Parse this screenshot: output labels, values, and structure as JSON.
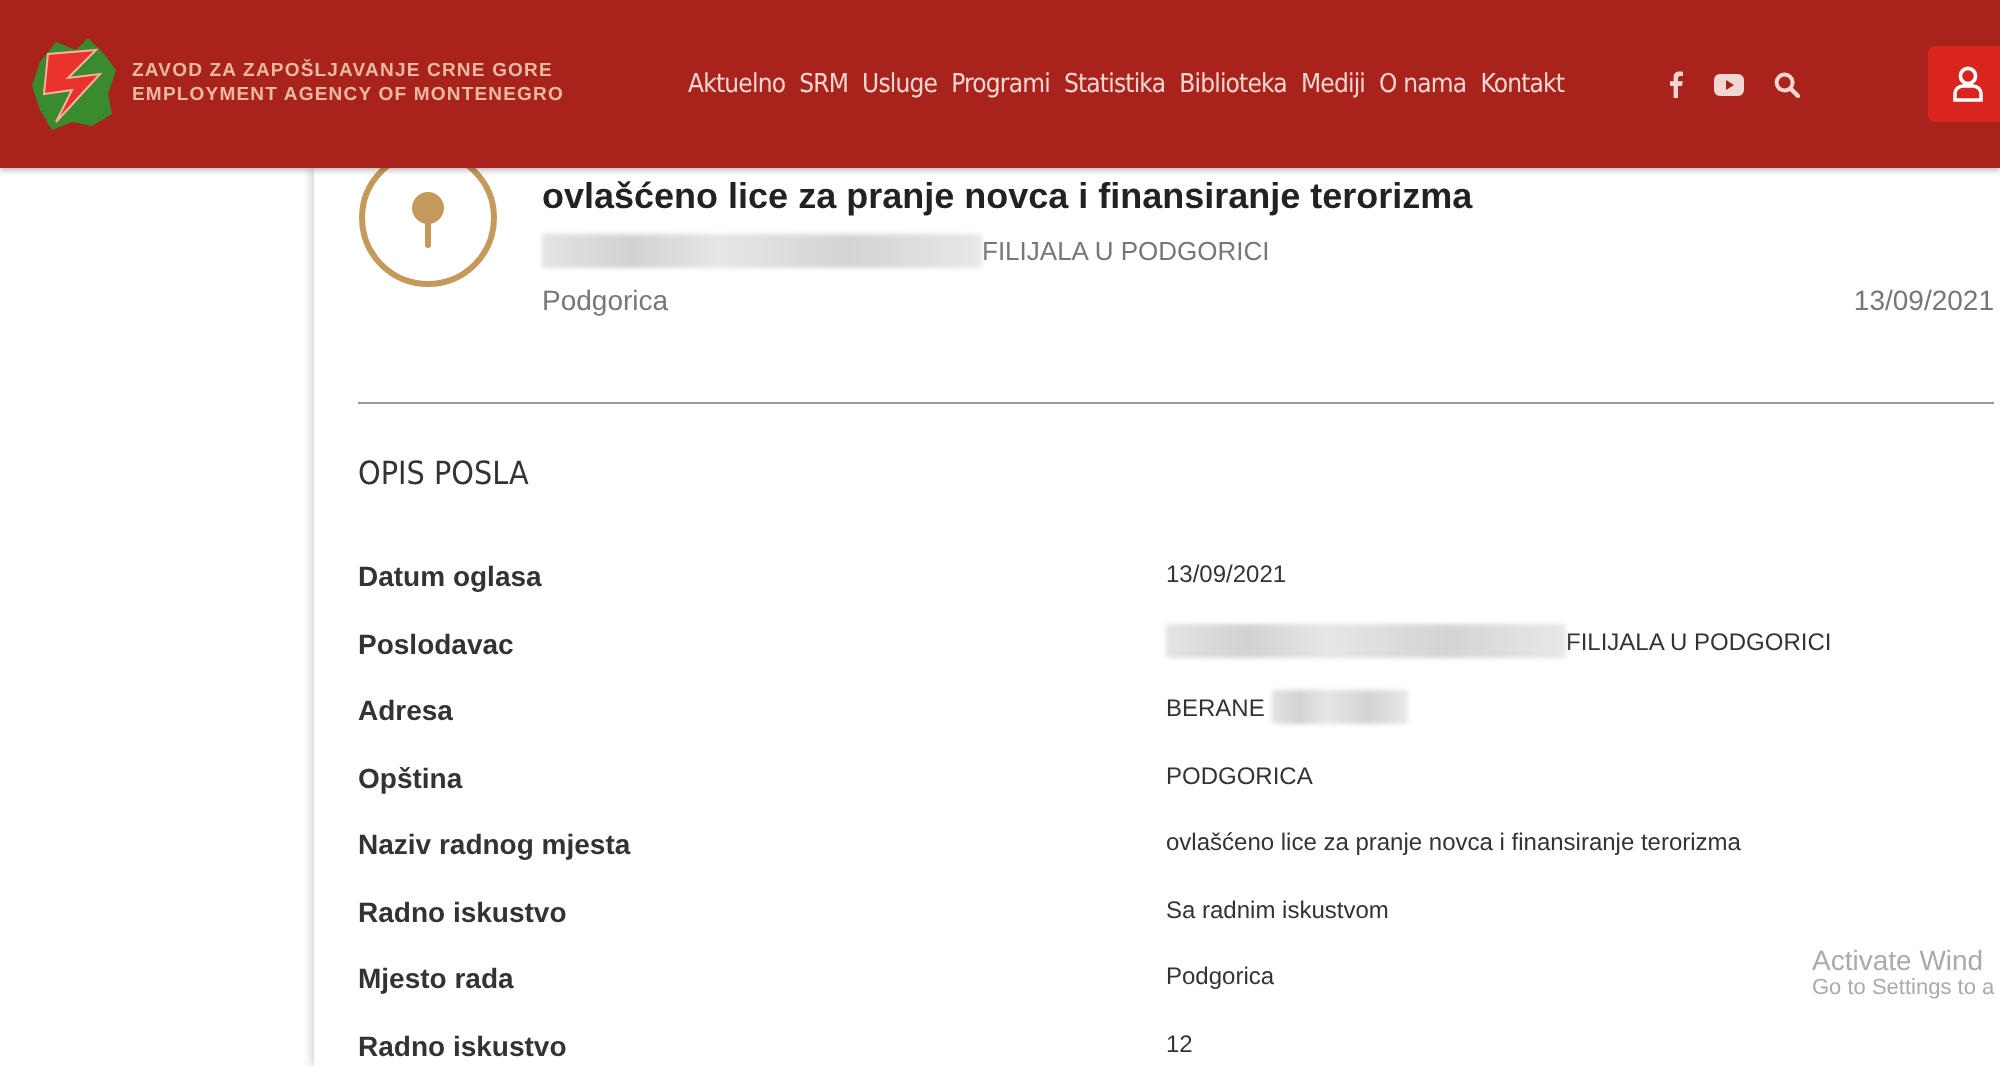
{
  "header": {
    "logo_line_1": "ZAVOD ZA ZAPOŠLJAVANJE CRNE GORE",
    "logo_line_2": "EMPLOYMENT AGENCY OF MONTENEGRO",
    "nav": [
      {
        "label": "Aktuelno"
      },
      {
        "label": "SRM"
      },
      {
        "label": "Usluge"
      },
      {
        "label": "Programi"
      },
      {
        "label": "Statistika"
      },
      {
        "label": "Biblioteka"
      },
      {
        "label": "Mediji"
      },
      {
        "label": "O nama"
      },
      {
        "label": "Kontakt"
      }
    ]
  },
  "job": {
    "title": "ovlašćeno lice za pranje novca i finansiranje terorizma",
    "employer": "FILIJALA U PODGORICI",
    "blurred_before": true,
    "city": "Podgorica",
    "date": "13/09/2021"
  },
  "section_title": "OPIS POSLA",
  "details": [
    {
      "label": "Datum oglasa",
      "value": "13/09/2021",
      "blurred_before": false,
      "blurred_after": false
    },
    {
      "label": "Poslodavac",
      "value": "FILIJALA U PODGORICI",
      "blurred_before": true,
      "blurred_after": false
    },
    {
      "label": "Adresa",
      "value": "BERANE",
      "blurred_before": false,
      "blurred_after": true
    },
    {
      "label": "Opština",
      "value": "PODGORICA",
      "blurred_before": false,
      "blurred_after": false
    },
    {
      "label": "Naziv radnog mjesta",
      "value": "ovlašćeno lice za pranje novca i finansiranje terorizma",
      "blurred_before": false,
      "blurred_after": false
    },
    {
      "label": "Radno iskustvo",
      "value": "Sa radnim iskustvom",
      "blurred_before": false,
      "blurred_after": false
    },
    {
      "label": "Mjesto rada",
      "value": "Podgorica",
      "blurred_before": false,
      "blurred_after": false
    },
    {
      "label": "Radno iskustvo",
      "value": "12",
      "blurred_before": false,
      "blurred_after": false
    }
  ],
  "os_notice": {
    "line_1": "Activate Wind",
    "line_2": "Go to Settings to a"
  }
}
